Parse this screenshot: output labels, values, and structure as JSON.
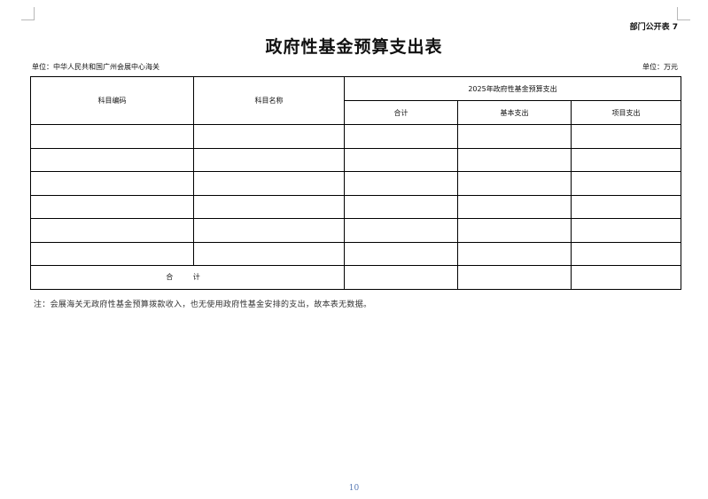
{
  "header": {
    "dept_label": "部门公开表 7",
    "title": "政府性基金预算支出表",
    "unit_org": "单位：中华人民共和国广州会展中心海关",
    "unit_currency": "单位：万元"
  },
  "table": {
    "col_code": "科目编码",
    "col_name": "科目名称",
    "group_header": "2025年政府性基金预算支出",
    "col_total": "合计",
    "col_basic": "基本支出",
    "col_project": "项目支出",
    "empty_rows": 6,
    "total_row_label": "合 计"
  },
  "note": "注：会展海关无政府性基金预算拨款收入，也无使用政府性基金安排的支出，故本表无数据。",
  "page_number": "10"
}
